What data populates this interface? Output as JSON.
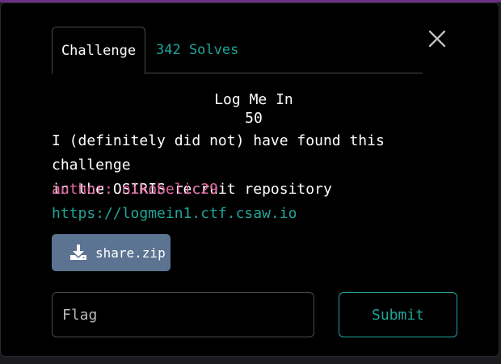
{
  "tabs": {
    "challenge_label": "Challenge",
    "solves_label": "342 Solves"
  },
  "challenge": {
    "name": "Log Me In",
    "points": "50",
    "description_line1": "I (definitely did not) have found this challenge",
    "description_line2": "in the OSIRIS recruit repository",
    "author": "author: nikobelic29",
    "link": "https://logmein1.ctf.csaw.io"
  },
  "download": {
    "label": "share.zip",
    "icon": "download-icon"
  },
  "form": {
    "flag_placeholder": "Flag",
    "submit_label": "Submit"
  },
  "colors": {
    "accent_teal": "#1fa59a",
    "author_pink": "#e567a3",
    "download_button": "#5c7392"
  }
}
